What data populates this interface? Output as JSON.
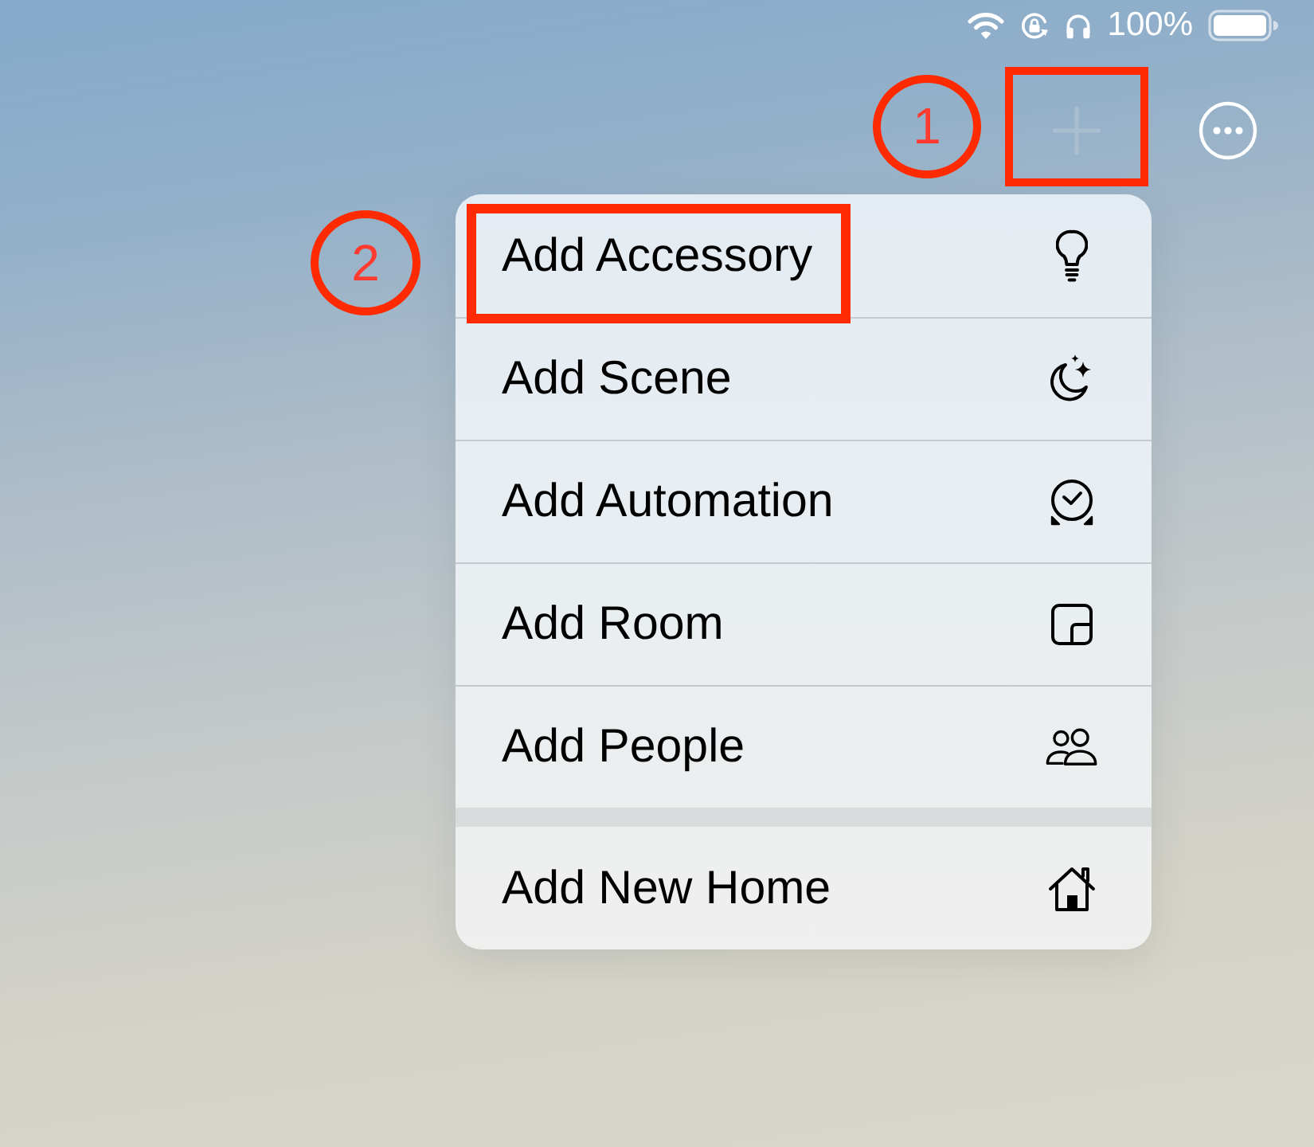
{
  "status_bar": {
    "battery_text": "100%"
  },
  "toolbar": {
    "add_button": {
      "highlighted": true,
      "step_marker": "1"
    }
  },
  "menu": {
    "sections": [
      {
        "items": [
          {
            "label": "Add Accessory",
            "highlighted": true,
            "step_marker": "2"
          },
          {
            "label": "Add Scene",
            "highlighted": false
          },
          {
            "label": "Add Automation",
            "highlighted": false
          },
          {
            "label": "Add Room",
            "highlighted": false
          },
          {
            "label": "Add People",
            "highlighted": false
          }
        ]
      },
      {
        "items": [
          {
            "label": "Add New Home",
            "highlighted": false
          }
        ]
      }
    ]
  }
}
